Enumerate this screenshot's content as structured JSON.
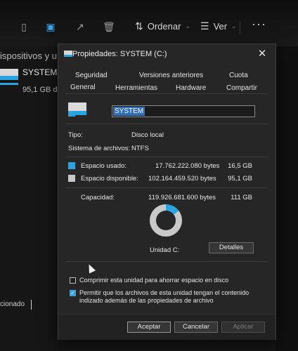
{
  "explorer": {
    "toolbar": {
      "sort_label": "Ordenar",
      "view_label": "Ver",
      "more": "···"
    },
    "sidebar_partial_text": "ispositivos y u",
    "drive": {
      "name": "SYSTEM (",
      "free": "95,1 GB di"
    },
    "status_partial": "cionado"
  },
  "dialog": {
    "title": "Propiedades: SYSTEM (C:)",
    "tabs_row1": [
      "Seguridad",
      "Versiones anteriores",
      "Cuota"
    ],
    "tabs_row2": [
      "General",
      "Herramientas",
      "Hardware",
      "Compartir"
    ],
    "volume_name": "SYSTEM",
    "type_label": "Tipo:",
    "type_value": "Disco local",
    "fs_label": "Sistema de archivos:",
    "fs_value": "NTFS",
    "used": {
      "label": "Espacio usado:",
      "bytes": "17.762.222.080 bytes",
      "gb": "16,5 GB",
      "color": "#2aa4e0"
    },
    "free": {
      "label": "Espacio disponible:",
      "bytes": "102.164.459.520 bytes",
      "gb": "95,1 GB",
      "color": "#c8c8c8"
    },
    "capacity": {
      "label": "Capacidad:",
      "bytes": "119.926.681.600 bytes",
      "gb": "111 GB"
    },
    "used_fraction": 0.148,
    "unit_label": "Unidad C:",
    "details_button": "Detalles",
    "compress_label": "Comprimir esta unidad para ahorrar espacio en disco",
    "compress_checked": false,
    "index_label": "Permitir que los archivos de esta unidad tengan el contenido indizado además de las propiedades de archivo",
    "index_checked": true,
    "buttons": {
      "accept": "Aceptar",
      "cancel": "Cancelar",
      "apply": "Aplicar"
    }
  }
}
